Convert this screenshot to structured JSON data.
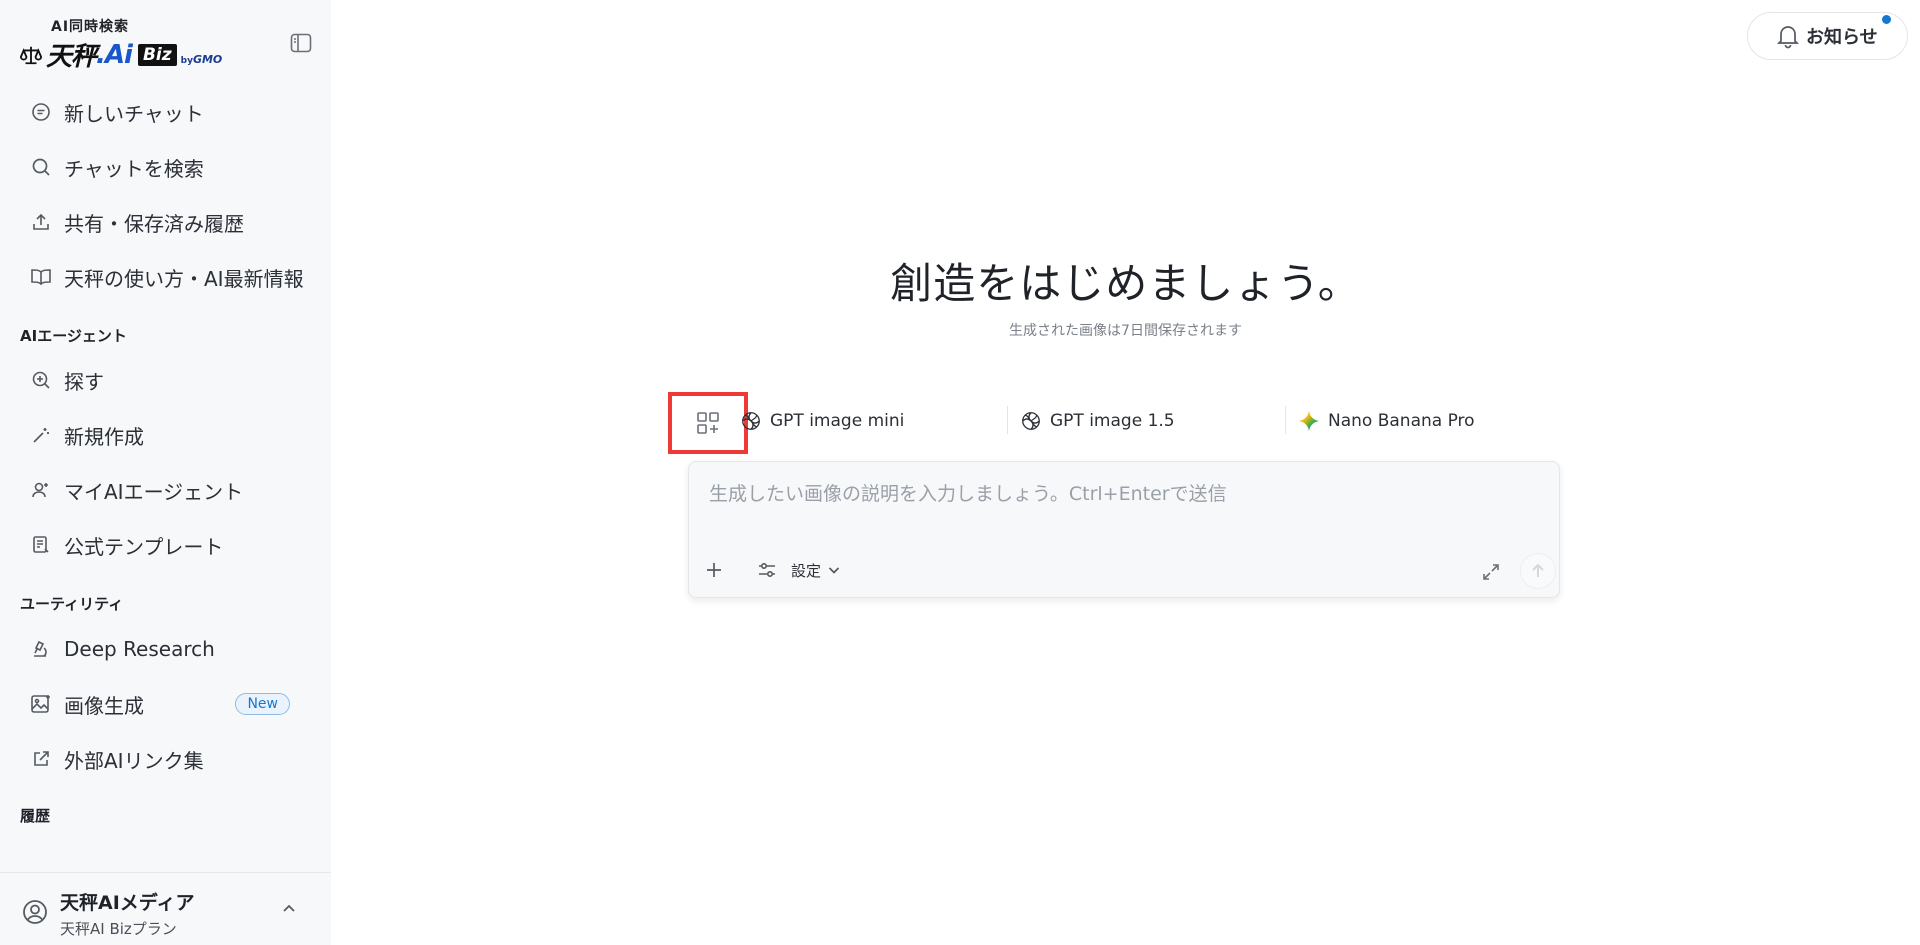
{
  "logo": {
    "subtitle": "AI同時検索",
    "name_main": "天秤",
    "name_ai": ".Ai",
    "name_biz": "Biz",
    "by": "by",
    "gmo": "GMO"
  },
  "sidebar": {
    "top_items": [
      {
        "label": "新しいチャット",
        "icon": "chat-bubble-icon"
      },
      {
        "label": "チャットを検索",
        "icon": "search-icon"
      },
      {
        "label": "共有・保存済み履歴",
        "icon": "share-upload-icon"
      },
      {
        "label": "天秤の使い方・AI最新情報",
        "icon": "book-icon"
      }
    ],
    "section_agents": "AIエージェント",
    "agent_items": [
      {
        "label": "探す",
        "icon": "zoom-plus-icon"
      },
      {
        "label": "新規作成",
        "icon": "magic-wand-icon"
      },
      {
        "label": "マイAIエージェント",
        "icon": "user-sparkle-icon"
      },
      {
        "label": "公式テンプレート",
        "icon": "template-document-icon"
      }
    ],
    "section_utility": "ユーティリティ",
    "utility_items": [
      {
        "label": "Deep Research",
        "icon": "microscope-icon"
      },
      {
        "label": "画像生成",
        "icon": "image-sparkle-icon",
        "badge": "New"
      },
      {
        "label": "外部AIリンク集",
        "icon": "external-link-icon"
      }
    ],
    "section_history": "履歴"
  },
  "user": {
    "name": "天秤AIメディア",
    "plan": "天秤AI Bizプラン"
  },
  "header": {
    "notifications_label": "お知らせ"
  },
  "main": {
    "title": "創造をはじめましょう。",
    "subtitle": "生成された画像は7日間保存されます",
    "models": [
      {
        "label": "GPT image mini",
        "icon": "openai-icon"
      },
      {
        "label": "GPT image 1.5",
        "icon": "openai-icon"
      },
      {
        "label": "Nano Banana Pro",
        "icon": "gemini-star-icon"
      }
    ],
    "prompt_placeholder": "生成したい画像の説明を入力しましょう。Ctrl+Enterで送信",
    "settings_label": "設定"
  },
  "colors": {
    "accent": "#1677d2",
    "highlight_box": "#ee3a34",
    "sidebar_bg": "#f7f8fa"
  }
}
